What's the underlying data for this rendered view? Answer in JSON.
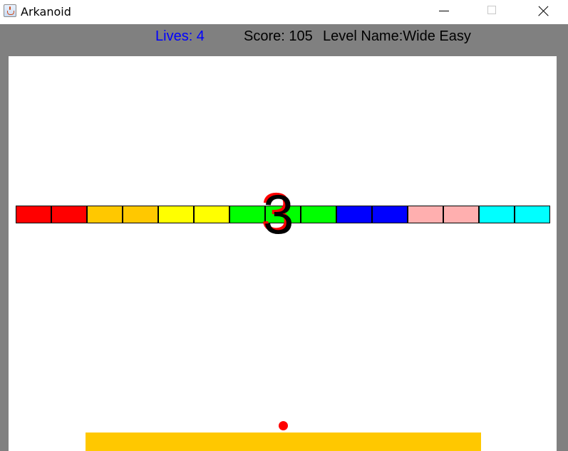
{
  "window": {
    "title": "Arkanoid"
  },
  "hud": {
    "lives": "Lives: 4",
    "score": "Score: 105",
    "level": "Level Name:Wide Easy"
  },
  "countdown": "3",
  "colors": {
    "frame": "#808080",
    "play_area": "#ffffff",
    "paddle": "#ffc800",
    "ball": "#ff0000",
    "lives_text": "#0000ff"
  },
  "bricks": [
    "#ff0000",
    "#ff0000",
    "#ffc800",
    "#ffc800",
    "#ffff00",
    "#ffff00",
    "#00ff00",
    "#00ff00",
    "#00ff00",
    "#0000ff",
    "#0000ff",
    "#ffafaf",
    "#ffafaf",
    "#00ffff",
    "#00ffff"
  ],
  "icons": {
    "app": "java-cup-icon",
    "minimize": "minimize-icon",
    "maximize": "maximize-icon",
    "close": "close-icon"
  }
}
